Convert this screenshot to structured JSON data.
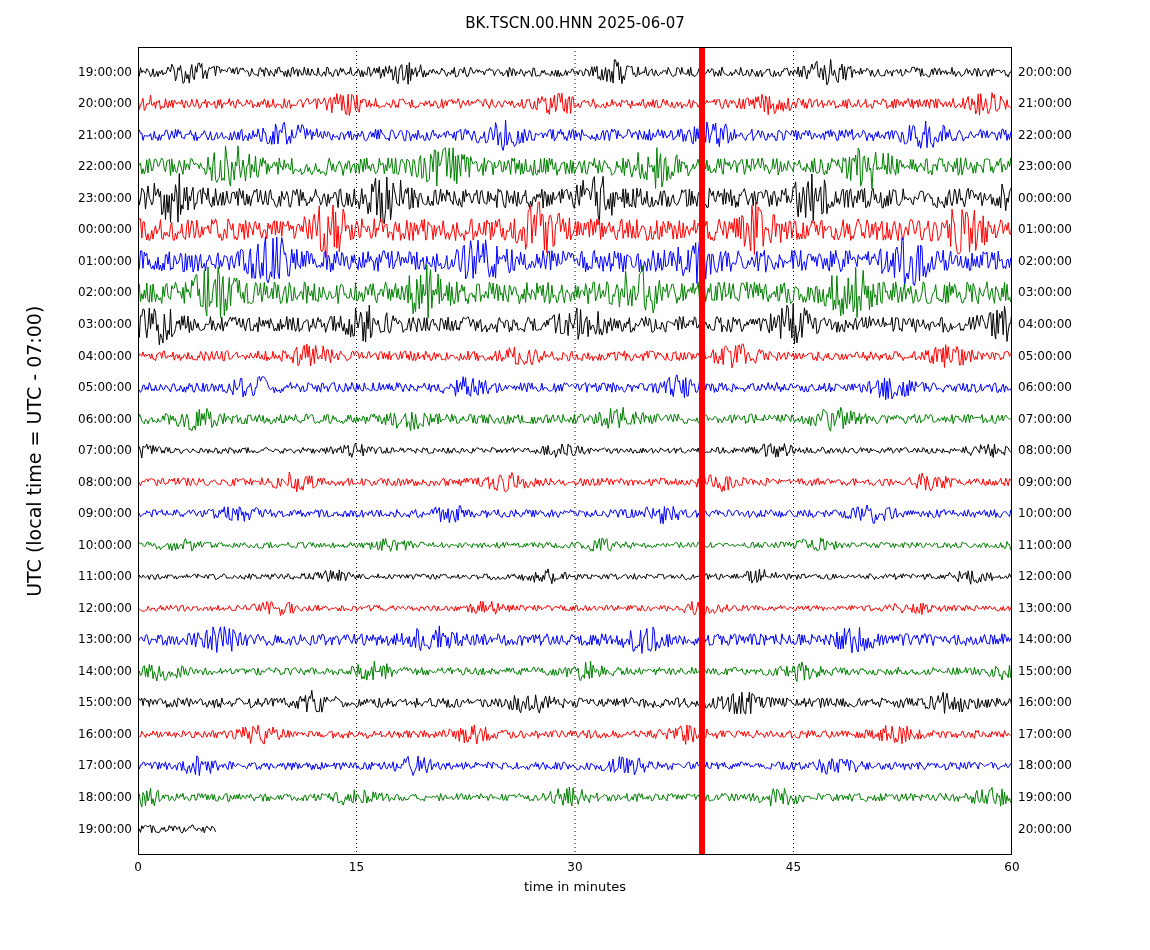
{
  "title": "BK.TSCN.00.HNN 2025-06-07",
  "ylabel": "UTC (local time = UTC - 07:00)",
  "xlabel": "time in minutes",
  "xticks": [
    "0",
    "15",
    "30",
    "45",
    "60"
  ],
  "traces": [
    {
      "left": "19:00:00",
      "right": "20:00:00",
      "color": "#000000",
      "level": 1
    },
    {
      "left": "20:00:00",
      "right": "21:00:00",
      "color": "#ff0000",
      "level": 1
    },
    {
      "left": "21:00:00",
      "right": "22:00:00",
      "color": "#0000ff",
      "level": 1
    },
    {
      "left": "22:00:00",
      "right": "23:00:00",
      "color": "#008000",
      "level": 1
    },
    {
      "left": "23:00:00",
      "right": "00:00:00",
      "color": "#000000",
      "level": 1
    },
    {
      "left": "00:00:00",
      "right": "01:00:00",
      "color": "#ff0000",
      "level": 1
    },
    {
      "left": "01:00:00",
      "right": "02:00:00",
      "color": "#0000ff",
      "level": 1
    },
    {
      "left": "02:00:00",
      "right": "03:00:00",
      "color": "#008000",
      "level": 1
    },
    {
      "left": "03:00:00",
      "right": "04:00:00",
      "color": "#000000",
      "level": 1
    },
    {
      "left": "04:00:00",
      "right": "05:00:00",
      "color": "#ff0000",
      "level": 1
    },
    {
      "left": "05:00:00",
      "right": "06:00:00",
      "color": "#0000ff",
      "level": 1
    },
    {
      "left": "06:00:00",
      "right": "07:00:00",
      "color": "#008000",
      "level": 1
    },
    {
      "left": "07:00:00",
      "right": "08:00:00",
      "color": "#000000",
      "level": 1
    },
    {
      "left": "08:00:00",
      "right": "09:00:00",
      "color": "#ff0000",
      "level": 1
    },
    {
      "left": "09:00:00",
      "right": "10:00:00",
      "color": "#0000ff",
      "level": 1
    },
    {
      "left": "10:00:00",
      "right": "11:00:00",
      "color": "#008000",
      "level": 1
    },
    {
      "left": "11:00:00",
      "right": "12:00:00",
      "color": "#000000",
      "level": 1
    },
    {
      "left": "12:00:00",
      "right": "13:00:00",
      "color": "#ff0000",
      "level": 1
    },
    {
      "left": "13:00:00",
      "right": "14:00:00",
      "color": "#0000ff",
      "level": 1
    },
    {
      "left": "14:00:00",
      "right": "15:00:00",
      "color": "#008000",
      "level": 1
    },
    {
      "left": "15:00:00",
      "right": "16:00:00",
      "color": "#000000",
      "level": 1
    },
    {
      "left": "16:00:00",
      "right": "17:00:00",
      "color": "#ff0000",
      "level": 1
    },
    {
      "left": "17:00:00",
      "right": "18:00:00",
      "color": "#0000ff",
      "level": 1
    },
    {
      "left": "18:00:00",
      "right": "19:00:00",
      "color": "#008000",
      "level": 1
    },
    {
      "left": "19:00:00",
      "right": "20:00:00",
      "color": "#000000",
      "level": 0.09
    }
  ]
}
